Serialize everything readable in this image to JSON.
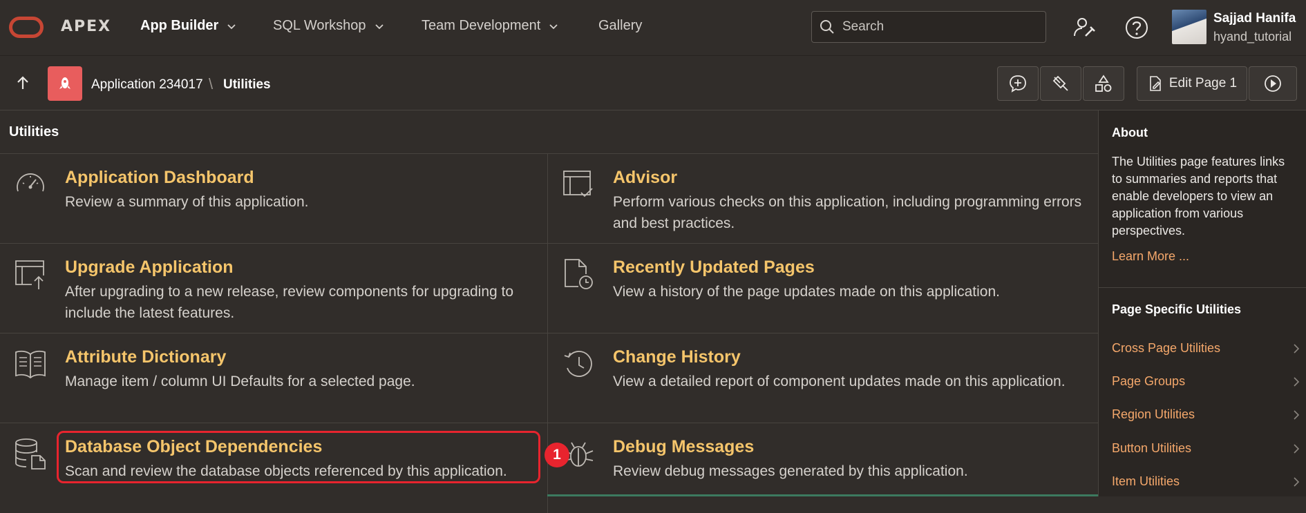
{
  "topnav": {
    "brand": "APEX",
    "items": [
      {
        "label": "App Builder",
        "active": true
      },
      {
        "label": "SQL Workshop"
      },
      {
        "label": "Team Development"
      },
      {
        "label": "Gallery"
      }
    ],
    "search_placeholder": "Search",
    "user_name": "Sajjad Hanifa",
    "user_login": "hyand_tutorial"
  },
  "breadcrumb": {
    "app": "Application 234017",
    "separator": "\\",
    "current": "Utilities"
  },
  "toolbar": {
    "edit_label": "Edit Page 1"
  },
  "main": {
    "title": "Utilities",
    "cards": [
      {
        "title": "Application Dashboard",
        "desc": "Review a summary of this application.",
        "icon": "dashboard-gauge-icon"
      },
      {
        "title": "Advisor",
        "desc": "Perform various checks on this application, including programming errors and best practices.",
        "icon": "window-check-icon"
      },
      {
        "title": "Upgrade Application",
        "desc": "After upgrading to a new release, review components for upgrading to include the latest features.",
        "icon": "window-upgrade-icon"
      },
      {
        "title": "Recently Updated Pages",
        "desc": "View a history of the page updates made on this application.",
        "icon": "page-clock-icon"
      },
      {
        "title": "Attribute Dictionary",
        "desc": "Manage item / column UI Defaults for a selected page.",
        "icon": "open-book-icon"
      },
      {
        "title": "Change History",
        "desc": "View a detailed report of component updates made on this application.",
        "icon": "history-clock-icon"
      },
      {
        "title": "Database Object Dependencies",
        "desc": "Scan and review the database objects referenced by this application.",
        "icon": "database-page-icon"
      },
      {
        "title": "Debug Messages",
        "desc": "Review debug messages generated by this application.",
        "icon": "bug-icon"
      }
    ],
    "step_badge": "1"
  },
  "sidebar": {
    "about_title": "About",
    "about_text": "The Utilities page features links to summaries and reports that enable developers to view an application from various perspectives.",
    "learn_more": "Learn More ...",
    "page_utils_title": "Page Specific Utilities",
    "items": [
      {
        "label": "Cross Page Utilities"
      },
      {
        "label": "Page Groups"
      },
      {
        "label": "Region Utilities"
      },
      {
        "label": "Button Utilities"
      },
      {
        "label": "Item Utilities"
      }
    ]
  },
  "colors": {
    "accent_title": "#f5c56b",
    "link": "#f5a86b",
    "highlight": "#e8242e",
    "brand_red": "#c74634"
  }
}
